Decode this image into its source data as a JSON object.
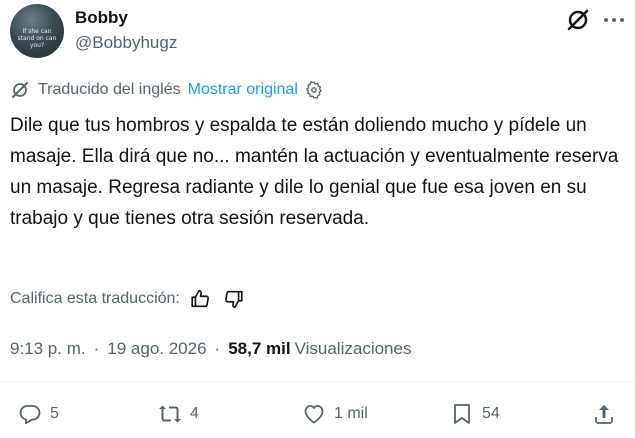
{
  "author": {
    "name": "Bobby",
    "handle": "@Bobbyhugz",
    "avatar_text": "If she can stand on can you?"
  },
  "header_icons": {
    "grok": "grok-icon",
    "more": "more-icon"
  },
  "translation": {
    "label": "Traducido del inglés",
    "show_original": "Mostrar original",
    "settings_icon": "gear-icon"
  },
  "tweet": {
    "text": "Dile que tus hombros y espalda te están doliendo mucho y pídele un masaje. Ella dirá que no... mantén la actuación y eventualmente reserva un masaje. Regresa radiante y dile lo genial que fue esa joven en su trabajo y que tienes otra sesión reservada."
  },
  "rating": {
    "label": "Califica esta traducción:",
    "up_icon": "thumbs-up-icon",
    "down_icon": "thumbs-down-icon"
  },
  "meta": {
    "time": "9:13 p. m.",
    "separator": "·",
    "date": "19 ago. 2026",
    "views_count": "58,7 mil",
    "views_label": "Visualizaciones"
  },
  "actions": {
    "replies": "5",
    "reposts": "4",
    "likes": "1 mil",
    "bookmarks": "54"
  },
  "colors": {
    "text": "#0f1419",
    "secondary": "#536471",
    "link": "#1d9bf0",
    "divider": "#eff3f4"
  }
}
